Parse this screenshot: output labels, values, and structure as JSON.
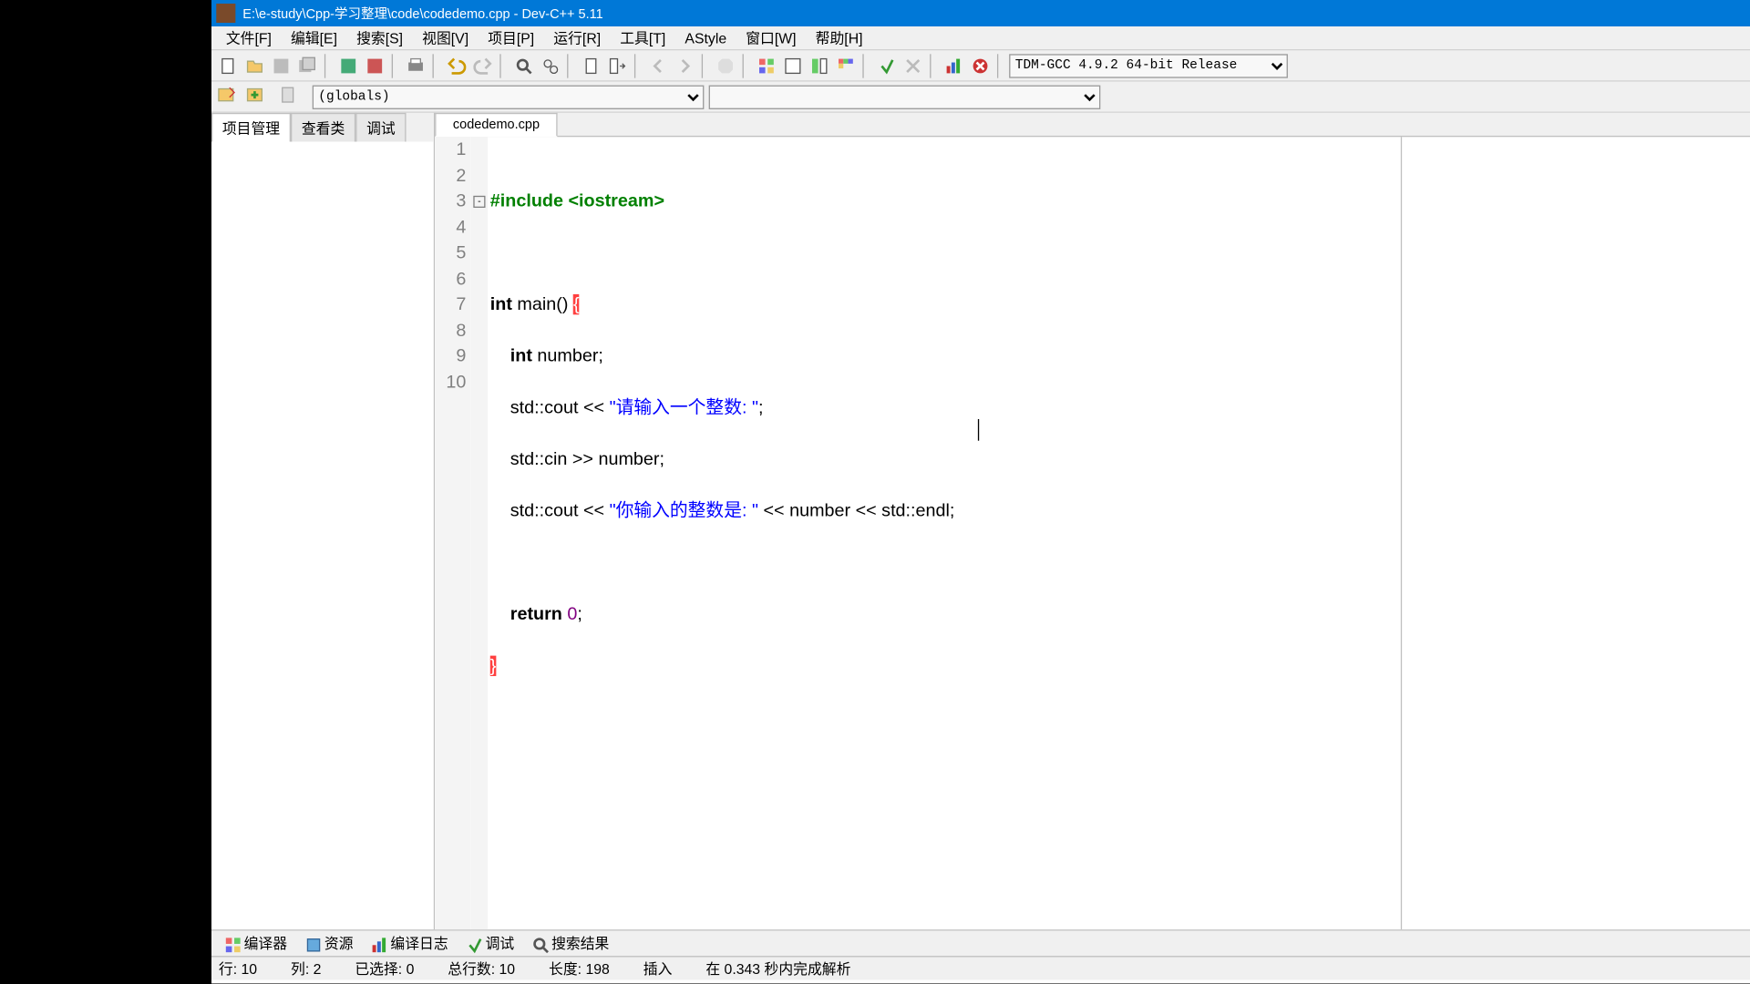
{
  "titlebar": {
    "title": "E:\\e-study\\Cpp-学习整理\\code\\codedemo.cpp - Dev-C++ 5.11",
    "min": "—",
    "max": "🗖",
    "close": "✕"
  },
  "menu": [
    "文件[F]",
    "编辑[E]",
    "搜索[S]",
    "视图[V]",
    "项目[P]",
    "运行[R]",
    "工具[T]",
    "AStyle",
    "窗口[W]",
    "帮助[H]"
  ],
  "compiler_dropdown": "TDM-GCC 4.9.2 64-bit Release",
  "globals_dropdown": "(globals)",
  "sidebar_tabs": [
    "项目管理",
    "查看类",
    "调试"
  ],
  "editor_tab": "codedemo.cpp",
  "code": {
    "lines": {
      "l1": {
        "n": "1"
      },
      "l2": {
        "n": "2"
      },
      "l3": {
        "n": "3"
      },
      "l4": {
        "n": "4"
      },
      "l5": {
        "n": "5"
      },
      "l6": {
        "n": "6"
      },
      "l7": {
        "n": "7"
      },
      "l8": {
        "n": "8"
      },
      "l9": {
        "n": "9"
      },
      "l10": {
        "n": "10"
      }
    },
    "tokens": {
      "include": "#include",
      "iostream": "<iostream>",
      "int": "int",
      "main": "main",
      "parens": "()",
      "lbrace": "{",
      "number_decl": " number;",
      "std_cout1": "    std::cout << ",
      "str1": "\"请输入一个整数: \"",
      "semi": ";",
      "std_cin": "    std::cin >> number;",
      "std_cout2": "    std::cout << ",
      "str2": "\"你输入的整数是: \"",
      "rest2": " << number << std::endl;",
      "return": "return",
      "zero": "0",
      "retrest": ";",
      "rbrace": "}"
    }
  },
  "bottom_tabs": [
    "编译器",
    "资源",
    "编译日志",
    "调试",
    "搜索结果"
  ],
  "statusbar": {
    "line": "行:   10",
    "col": "列:   2",
    "sel": "已选择:   0",
    "total": "总行数:   10",
    "len": "长度:   198",
    "mode": "插入",
    "parse": "在 0.343 秒内完成解析"
  }
}
